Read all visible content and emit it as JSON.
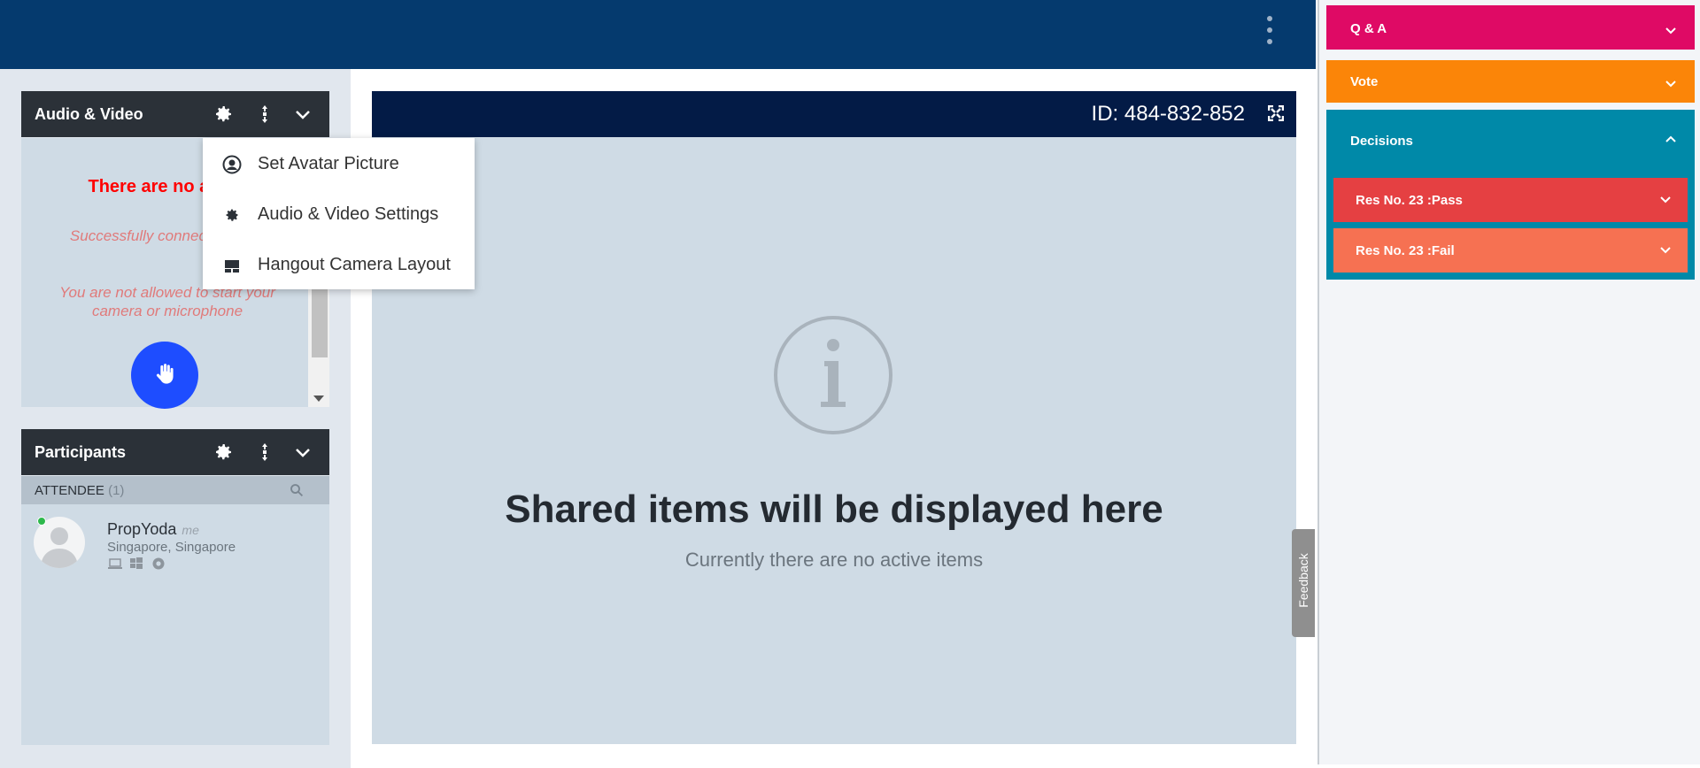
{
  "colors": {
    "topbar": "#053a6e",
    "qa": "#df0a65",
    "vote": "#fb8508",
    "decisions": "#0089a8",
    "res_pass": "#e54042",
    "res_fail": "#f67152",
    "raise_hand": "#1e4dff"
  },
  "audio_video": {
    "title": "Audio & Video",
    "no_streams": "There are no a streams",
    "connected_msg": "Successfully connecte server",
    "not_allowed_msg": "You are not allowed to start your camera or microphone"
  },
  "menu": {
    "items": [
      {
        "label": "Set Avatar Picture",
        "icon": "avatar-icon"
      },
      {
        "label": "Audio & Video Settings",
        "icon": "gear-icon"
      },
      {
        "label": "Hangout Camera Layout",
        "icon": "layout-icon"
      }
    ]
  },
  "participants": {
    "title": "Participants",
    "section_label": "ATTENDEE",
    "section_count": "(1)",
    "people": [
      {
        "name": "PropYoda",
        "tag": "me",
        "location": "Singapore, Singapore"
      }
    ]
  },
  "share": {
    "meeting_id": "ID: 484-832-852",
    "title": "Shared items will be displayed here",
    "subtitle": "Currently there are no active items"
  },
  "feedback_label": "Feedback",
  "right_panel": {
    "qa": "Q & A",
    "vote": "Vote",
    "decisions": "Decisions",
    "resolutions": [
      {
        "label": "Res No. 23 :Pass"
      },
      {
        "label": "Res No. 23 :Fail"
      }
    ]
  }
}
